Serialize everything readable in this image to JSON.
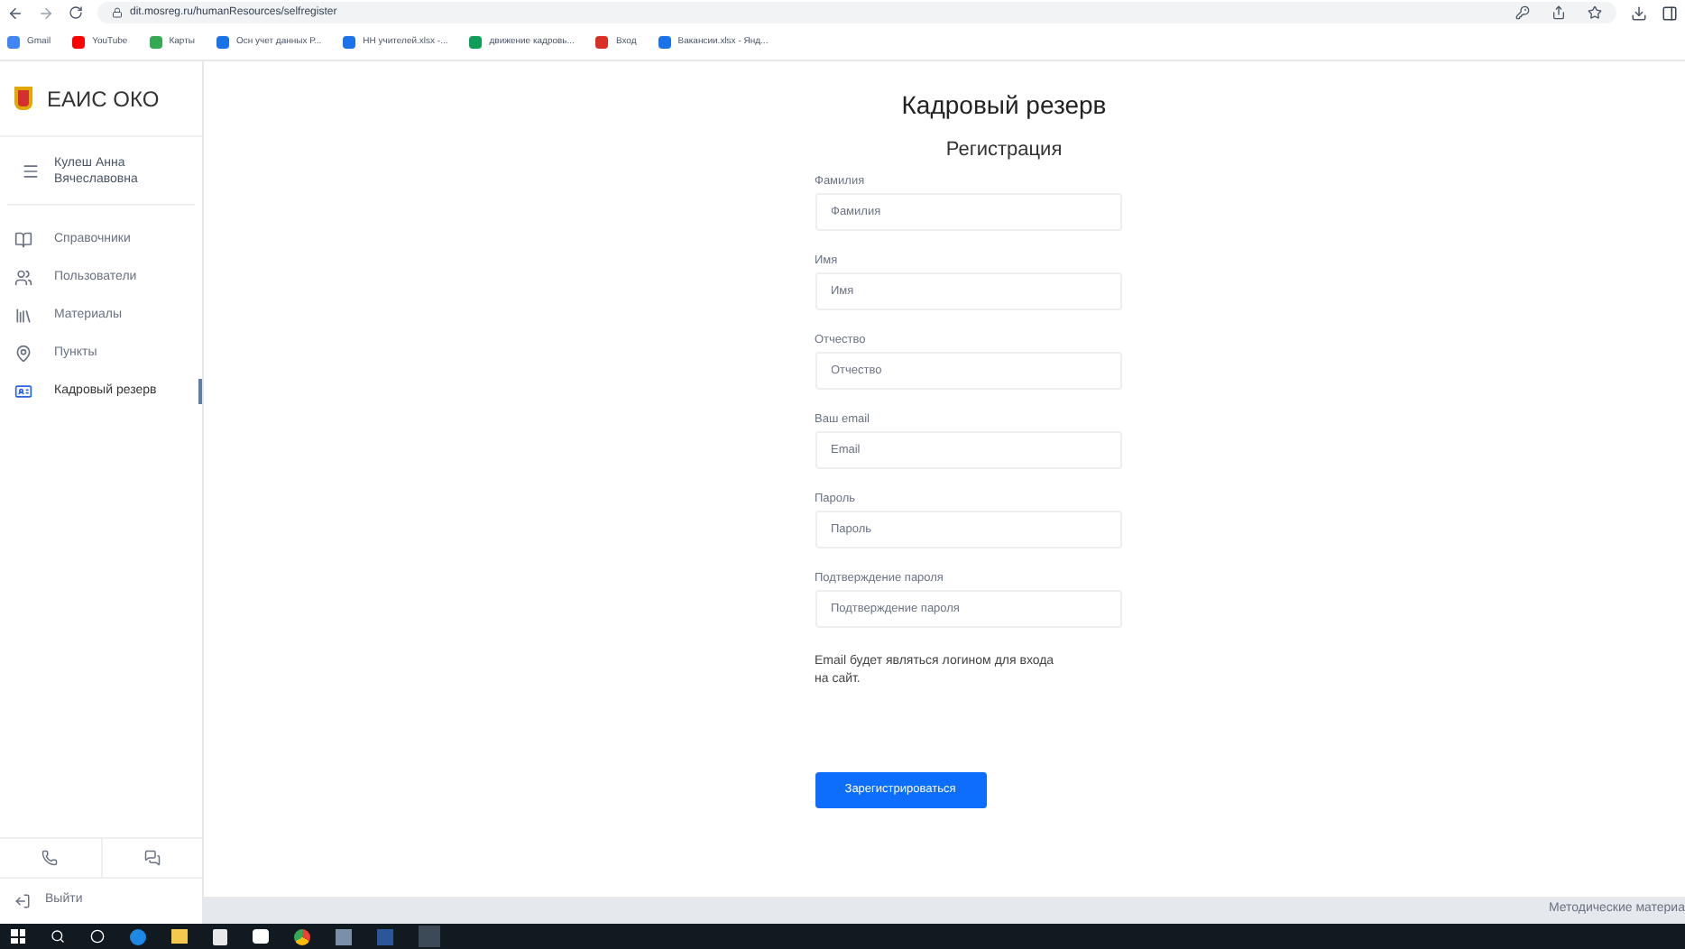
{
  "browser": {
    "url": "dit.mosreg.ru/humanResources/selfregister",
    "bookmarks": [
      {
        "label": "Gmail",
        "color": "#4285f4"
      },
      {
        "label": "YouTube",
        "color": "#ff0000"
      },
      {
        "label": "Карты",
        "color": "#34a853"
      },
      {
        "label": "Осн учет данных Р...",
        "color": "#1a73e8"
      },
      {
        "label": "НН учителей.xlsx -...",
        "color": "#1a73e8"
      },
      {
        "label": "движение кадровь...",
        "color": "#0f9d58"
      },
      {
        "label": "Вход",
        "color": "#d93025"
      },
      {
        "label": "Вакансии.xlsx - Янд...",
        "color": "#1a73e8"
      }
    ]
  },
  "app": {
    "title": "ЕАИС ОКО",
    "user": "Кулеш Анна Вячеславовна",
    "nav": [
      {
        "label": "Справочники",
        "kind": "book",
        "selected": false
      },
      {
        "label": "Пользователи",
        "kind": "users",
        "selected": false
      },
      {
        "label": "Материалы",
        "kind": "library",
        "selected": false
      },
      {
        "label": "Пункты",
        "kind": "pin",
        "selected": false
      },
      {
        "label": "Кадровый резерв",
        "kind": "card",
        "selected": true
      }
    ],
    "logout": "Выйти",
    "footer": "Методические материа"
  },
  "form": {
    "title": "Кадровый резерв",
    "subtitle": "Регистрация",
    "fields": [
      {
        "label": "Фамилия",
        "placeholder": "Фамилия"
      },
      {
        "label": "Имя",
        "placeholder": "Имя"
      },
      {
        "label": "Отчество",
        "placeholder": "Отчество"
      },
      {
        "label": "Ваш email",
        "placeholder": "Email"
      },
      {
        "label": "Пароль",
        "placeholder": "Пароль"
      },
      {
        "label": "Подтверждение пароля",
        "placeholder": "Подтверждение пароля"
      }
    ],
    "note": "Email будет являться логином для входа на сайт.",
    "submit": "Зарегистрироваться"
  }
}
